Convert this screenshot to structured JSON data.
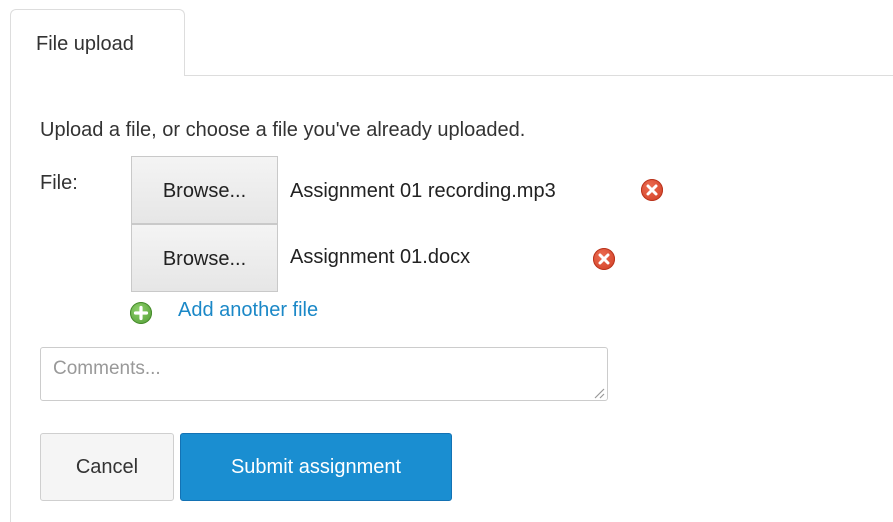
{
  "tabs": [
    {
      "label": "File upload",
      "active": true
    }
  ],
  "upload": {
    "intro_text": "Upload a file, or choose a file you've already uploaded.",
    "file_label": "File:",
    "files": [
      {
        "browse_label": "Browse...",
        "file_name": "Assignment 01 recording.mp3",
        "remove_icon": "remove-icon"
      },
      {
        "browse_label": "Browse...",
        "file_name": "Assignment 01.docx",
        "remove_icon": "remove-icon"
      }
    ],
    "add_another_label": "Add another file",
    "add_icon": "plus-circle-icon"
  },
  "comments": {
    "placeholder": "Comments...",
    "value": ""
  },
  "actions": {
    "cancel_label": "Cancel",
    "submit_label": "Submit assignment"
  },
  "colors": {
    "link": "#1b88c7",
    "submit_bg": "#1a8ed1",
    "remove_icon": "#d9432a",
    "add_icon": "#5fae3f"
  }
}
